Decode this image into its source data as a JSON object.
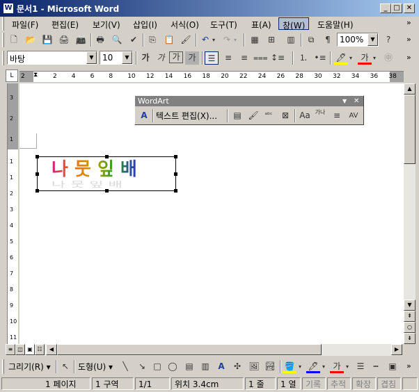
{
  "window": {
    "title": "문서1 - Microsoft Word",
    "app_icon": "word-icon"
  },
  "menu": [
    {
      "label": "파일(F)",
      "active": false
    },
    {
      "label": "편집(E)",
      "active": false
    },
    {
      "label": "보기(V)",
      "active": false
    },
    {
      "label": "삽입(I)",
      "active": false
    },
    {
      "label": "서식(O)",
      "active": false
    },
    {
      "label": "도구(T)",
      "active": false
    },
    {
      "label": "표(A)",
      "active": false
    },
    {
      "label": "창(W)",
      "active": true
    },
    {
      "label": "도움말(H)",
      "active": false
    }
  ],
  "standard_toolbar": {
    "zoom": "100%"
  },
  "format_toolbar": {
    "font": "바탕",
    "size": "10",
    "bold_label": "가",
    "italic_label": "가",
    "underline_label": "가",
    "char_shade_label": "가",
    "font_color_label": "가",
    "enclose_label": "㊥"
  },
  "ruler_labels": [
    "2",
    "2",
    "4",
    "6",
    "8",
    "10",
    "12",
    "14",
    "16",
    "18",
    "20",
    "22",
    "24",
    "26",
    "28",
    "30",
    "32",
    "34",
    "36",
    "38"
  ],
  "vruler_labels": [
    "3",
    "2",
    "1",
    "1",
    "1",
    "2",
    "3",
    "4",
    "5",
    "6",
    "7",
    "8",
    "9",
    "10",
    "11"
  ],
  "wordart_toolbar": {
    "title": "WordArt",
    "edit_text_label": "텍스트 편집(X)...",
    "vertical_label": "가나"
  },
  "wordart": {
    "text": "나 뭇 잎  배"
  },
  "drawing_toolbar": {
    "draw_label": "그리기(R)",
    "autoshape_label": "도형(U)",
    "font_color_label": "가"
  },
  "status": {
    "page": "1 페이지",
    "section": "1 구역",
    "pages": "1/1",
    "position": "위치 3.4cm",
    "line": "1 줄",
    "column": "1 열",
    "rec": "기록",
    "trk": "추적",
    "ext": "확장",
    "ovr": "겹침"
  },
  "colors": {
    "title_start": "#0a246a",
    "title_end": "#a6caf0",
    "chrome": "#d4d0c8"
  }
}
